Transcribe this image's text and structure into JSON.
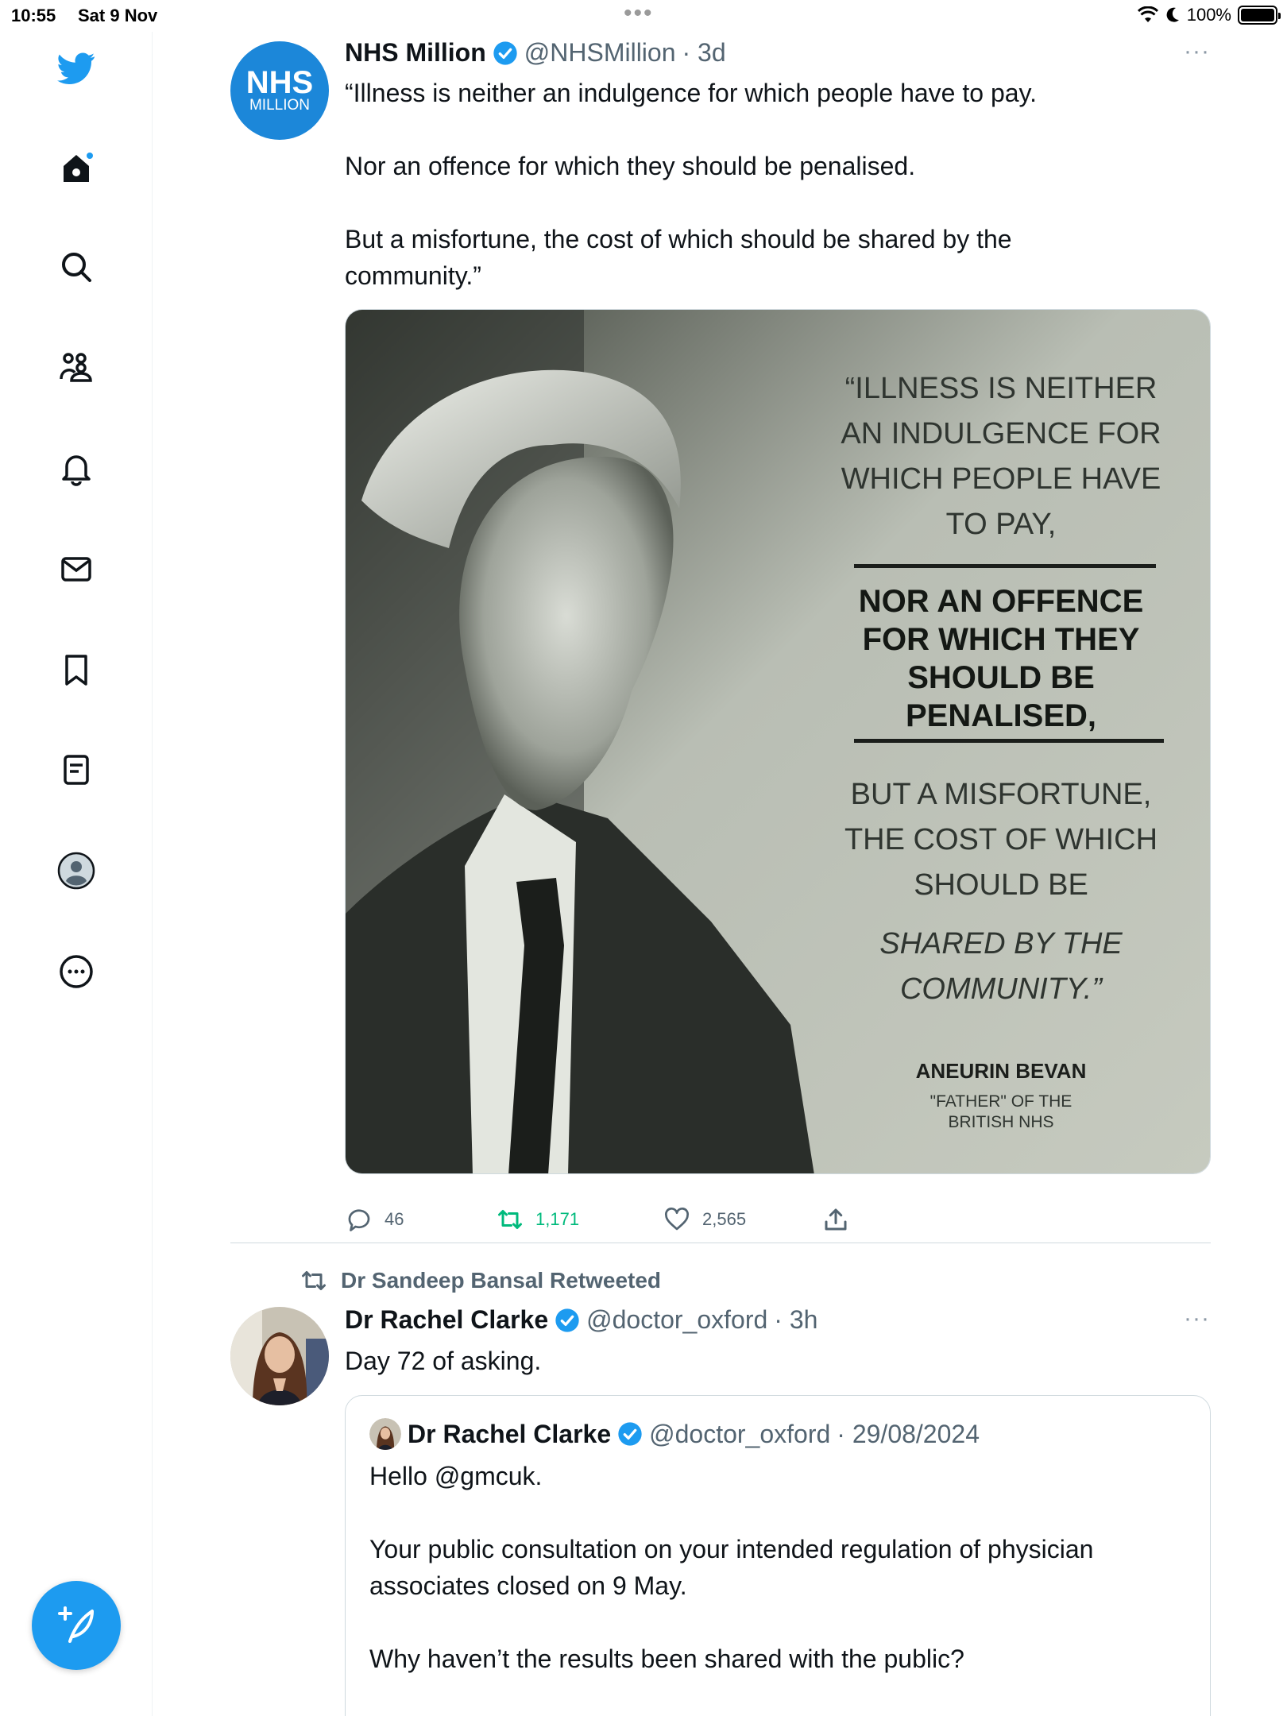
{
  "status_bar": {
    "time": "10:55",
    "date": "Sat 9 Nov",
    "battery": "100%"
  },
  "sidebar": {
    "items": [
      {
        "name": "twitter-logo-icon"
      },
      {
        "name": "home-icon"
      },
      {
        "name": "search-icon"
      },
      {
        "name": "communities-icon"
      },
      {
        "name": "notifications-icon"
      },
      {
        "name": "messages-icon"
      },
      {
        "name": "bookmarks-icon"
      },
      {
        "name": "lists-icon"
      },
      {
        "name": "profile-icon"
      },
      {
        "name": "more-icon"
      }
    ],
    "compose": "compose-icon"
  },
  "tweet1": {
    "avatar": {
      "line1": "NHS",
      "line2": "MILLION"
    },
    "name": "NHS Million",
    "handle": "@NHSMillion",
    "time": "· 3d",
    "more": "···",
    "text": [
      "“Illness is neither an indulgence for which people have to pay.",
      "Nor an offence for which they should be penalised.",
      "But a misfortune, the cost of which should be shared by the community.”"
    ],
    "image_text": {
      "q1": [
        "“ILLNESS IS NEITHER",
        "AN INDULGENCE FOR",
        "WHICH PEOPLE HAVE",
        "TO PAY,"
      ],
      "q2": [
        "NOR AN OFFENCE",
        "FOR WHICH THEY",
        "SHOULD BE",
        "PENALISED,"
      ],
      "q3": [
        "BUT A MISFORTUNE,",
        "THE COST OF WHICH",
        "SHOULD BE"
      ],
      "q4": [
        "SHARED BY THE",
        "COMMUNITY.”"
      ],
      "author": "ANEURIN BEVAN",
      "author_sub": [
        "\"FATHER\" OF THE",
        "BRITISH NHS"
      ]
    },
    "replies": "46",
    "retweets": "1,171",
    "likes": "2,565"
  },
  "tweet2": {
    "retweeted_by": "Dr Sandeep Bansal Retweeted",
    "name": "Dr Rachel Clarke",
    "handle": "@doctor_oxford",
    "time": "· 3h",
    "more": "···",
    "text": "Day 72 of asking.",
    "quote": {
      "name": "Dr Rachel Clarke",
      "handle": "@doctor_oxford",
      "time": "· 29/08/2024",
      "text": [
        "Hello @gmcuk.",
        "Your public consultation on your intended regulation of physician associates closed on 9 May.",
        "Why haven’t the results been shared with the public?"
      ]
    }
  },
  "colors": {
    "accent": "#1d9bf0",
    "retweet_green": "#00ba7c",
    "text": "#0f1419",
    "muted": "#536471"
  }
}
